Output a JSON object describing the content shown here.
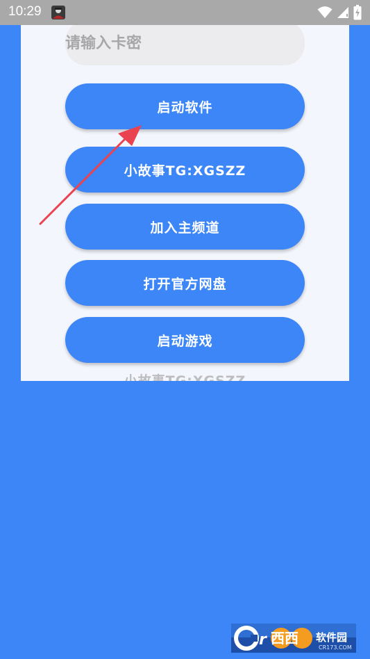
{
  "status_bar": {
    "time": "10:29",
    "icons": [
      "app-avatar-icon",
      "wifi-icon",
      "signal-icon",
      "battery-icon"
    ]
  },
  "card": {
    "placeholder": "请输入卡密",
    "value": ""
  },
  "buttons": [
    {
      "label": "启动软件"
    },
    {
      "label": "小故事TG:XGSZZ"
    },
    {
      "label": "加入主频道"
    },
    {
      "label": "打开官方网盘"
    },
    {
      "label": "启动游戏"
    }
  ],
  "footer": {
    "text": "小故事TG:XGSZZ"
  },
  "watermark": {
    "brand": "西西软件园",
    "url": "CR173.COM"
  },
  "colors": {
    "background": "#3d86f8",
    "button": "#3d86f8",
    "panel": "#f4f6fd",
    "arrow": "#e8434f"
  }
}
